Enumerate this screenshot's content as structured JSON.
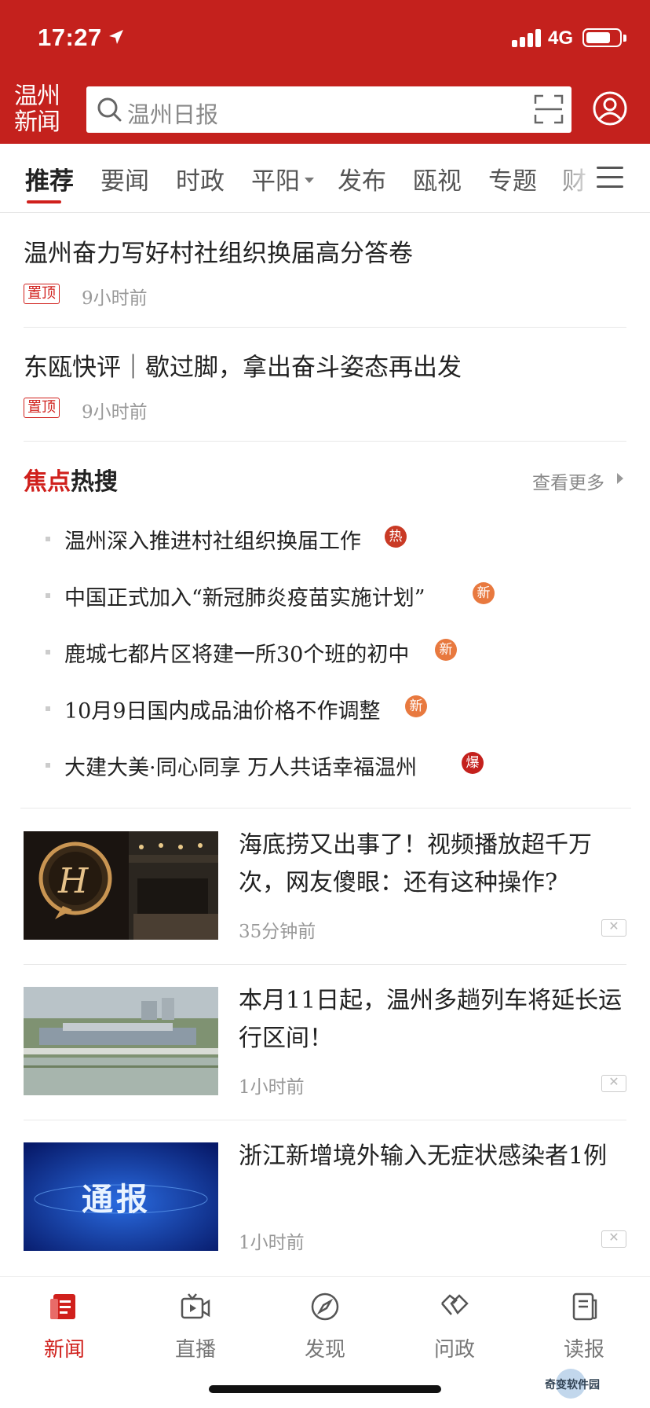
{
  "status_bar": {
    "time": "17:27",
    "network": "4G"
  },
  "header": {
    "logo_line1": "温州",
    "logo_line2": "新闻",
    "search_placeholder": "温州日报"
  },
  "tabs": [
    {
      "label": "推荐",
      "active": true
    },
    {
      "label": "要闻"
    },
    {
      "label": "时政"
    },
    {
      "label": "平阳"
    },
    {
      "label": "发布"
    },
    {
      "label": "瓯视"
    },
    {
      "label": "专题"
    },
    {
      "label": "财"
    }
  ],
  "pinned": [
    {
      "title": "温州奋力写好村社组织换届高分答卷",
      "tag": "置顶",
      "time": "9小时前"
    },
    {
      "title": "东瓯快评｜歇过脚，拿出奋斗姿态再出发",
      "tag": "置顶",
      "time": "9小时前"
    }
  ],
  "hot_search": {
    "title_red": "焦点",
    "title_black": "热搜",
    "more": "查看更多",
    "items": [
      {
        "text": "温州深入推进村社组织换届工作",
        "badge": "热"
      },
      {
        "text": "中国正式加入“新冠肺炎疫苗实施计划”",
        "badge": "新"
      },
      {
        "text": "鹿城七都片区将建一所30个班的初中",
        "badge": "新"
      },
      {
        "text": "10月9日国内成品油价格不作调整",
        "badge": "新"
      },
      {
        "text": "大建大美·同心同享 万人共话幸福温州",
        "badge": "爆"
      }
    ]
  },
  "news": [
    {
      "title": "海底捞又出事了！视频播放超千万次，网友傻眼：还有这种操作?",
      "time": "35分钟前",
      "thumb": "restaurant-logo"
    },
    {
      "title": "本月11日起，温州多趟列车将延长运行区间！",
      "time": "1小时前",
      "thumb": "train-station-aerial"
    },
    {
      "title": "浙江新增境外输入无症状感染者1例",
      "time": "1小时前",
      "thumb_text": "通报"
    }
  ],
  "close_symbol": "✕",
  "bottom_nav": [
    {
      "label": "新闻",
      "active": true
    },
    {
      "label": "直播"
    },
    {
      "label": "发现"
    },
    {
      "label": "问政"
    },
    {
      "label": "读报"
    }
  ],
  "watermark": "奇变软件园",
  "colors": {
    "brand_red": "#c4211d",
    "accent_red": "#d0201c",
    "new_badge": "#e8793f"
  }
}
